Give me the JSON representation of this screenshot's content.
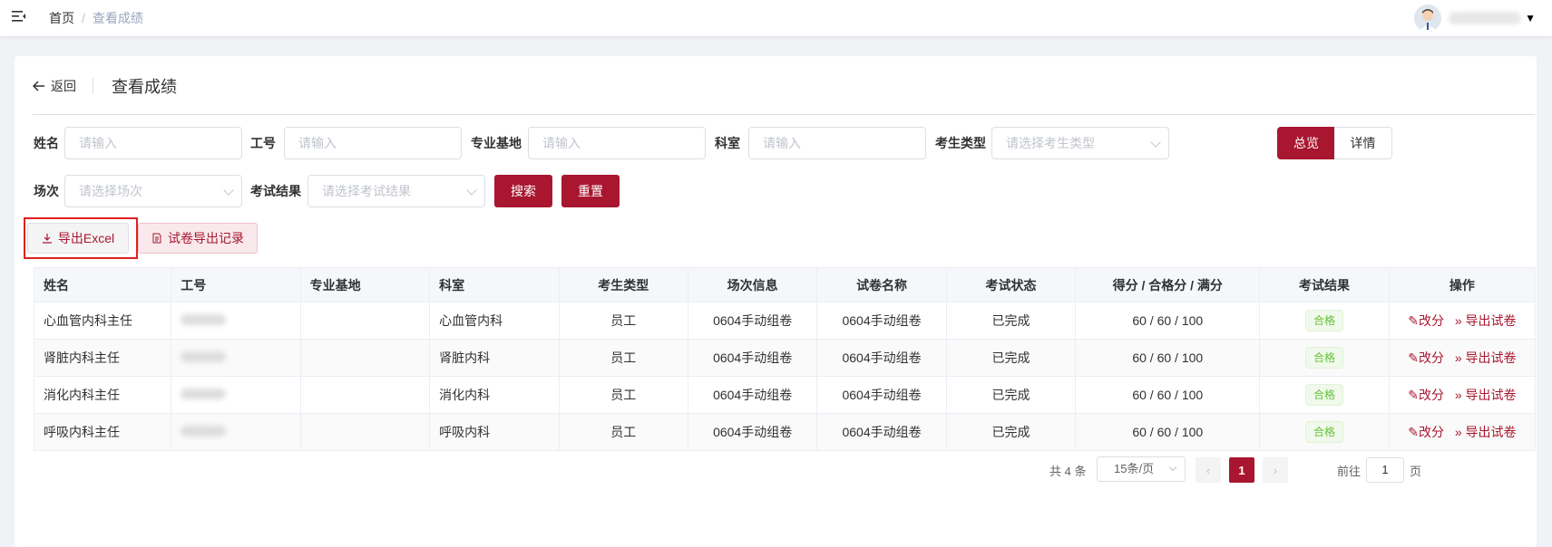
{
  "header": {
    "breadcrumb": {
      "home": "首页",
      "separator": "/",
      "current": "查看成绩"
    }
  },
  "page": {
    "back_label": "返回",
    "title": "查看成绩"
  },
  "filters": {
    "name": {
      "label": "姓名",
      "placeholder": "请输入"
    },
    "employee_id": {
      "label": "工号",
      "placeholder": "请输入"
    },
    "base": {
      "label": "专业基地",
      "placeholder": "请输入"
    },
    "department": {
      "label": "科室",
      "placeholder": "请输入"
    },
    "candidate_type": {
      "label": "考生类型",
      "placeholder": "请选择考生类型"
    },
    "session": {
      "label": "场次",
      "placeholder": "请选择场次"
    },
    "result": {
      "label": "考试结果",
      "placeholder": "请选择考试结果"
    },
    "search_label": "搜索",
    "reset_label": "重置"
  },
  "view_toggle": {
    "overview": "总览",
    "detail": "详情"
  },
  "actions": {
    "export_excel": "导出Excel",
    "export_record": "试卷导出记录"
  },
  "table": {
    "columns": [
      "姓名",
      "工号",
      "专业基地",
      "科室",
      "考生类型",
      "场次信息",
      "试卷名称",
      "考试状态",
      "得分 / 合格分 / 满分",
      "考试结果",
      "操作"
    ],
    "rows": [
      {
        "name": "心血管内科主任",
        "dept": "心血管内科",
        "type": "员工",
        "session": "0604手动组卷",
        "paper": "0604手动组卷",
        "status": "已完成",
        "score": "60 / 60 / 100",
        "result": "合格"
      },
      {
        "name": "肾脏内科主任",
        "dept": "肾脏内科",
        "type": "员工",
        "session": "0604手动组卷",
        "paper": "0604手动组卷",
        "status": "已完成",
        "score": "60 / 60 / 100",
        "result": "合格"
      },
      {
        "name": "消化内科主任",
        "dept": "消化内科",
        "type": "员工",
        "session": "0604手动组卷",
        "paper": "0604手动组卷",
        "status": "已完成",
        "score": "60 / 60 / 100",
        "result": "合格"
      },
      {
        "name": "呼吸内科主任",
        "dept": "呼吸内科",
        "type": "员工",
        "session": "0604手动组卷",
        "paper": "0604手动组卷",
        "status": "已完成",
        "score": "60 / 60 / 100",
        "result": "合格"
      }
    ],
    "op_edit": "改分",
    "op_export": "导出试卷"
  },
  "pagination": {
    "total": "共 4 条",
    "page_size": "15条/页",
    "current_page": "1",
    "goto_prefix": "前往",
    "goto_value": "1",
    "goto_suffix": "页"
  },
  "colors": {
    "primary": "#a8172f",
    "pass_tag": "#67c23a",
    "highlight_box": "#e02020"
  }
}
